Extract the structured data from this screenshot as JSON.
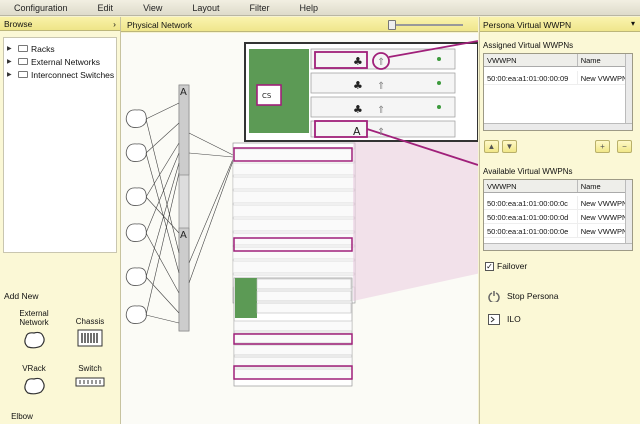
{
  "menu": [
    "Configuration",
    "Edit",
    "View",
    "Layout",
    "Filter",
    "Help"
  ],
  "left": {
    "title": "Browse",
    "tree": [
      "Racks",
      "External Networks",
      "Interconnect Switches"
    ],
    "add_new": "Add New",
    "palette": {
      "external_network": "External Network",
      "chassis": "Chassis",
      "vrack": "VRack",
      "switch": "Switch",
      "elbow": "Elbow"
    }
  },
  "center": {
    "title": "Physical Network",
    "chassis_label": "CS"
  },
  "right": {
    "title": "Persona Virtual WWPN",
    "assigned_label": "Assigned Virtual WWPNs",
    "assigned_headers": [
      "VWWPN",
      "Name"
    ],
    "assigned_rows": [
      [
        "50:00:ea:a1:01:00:00:09",
        "New VWWPN"
      ]
    ],
    "available_label": "Available Virtual WWPNs",
    "available_headers": [
      "VWWPN",
      "Name"
    ],
    "available_rows": [
      [
        "50:00:ea:a1:01:00:00:0c",
        "New VWWPN"
      ],
      [
        "50:00:ea:a1:01:00:00:0d",
        "New VWWPN"
      ],
      [
        "50:00:ea:a1:01:00:00:0e",
        "New VWWPN"
      ]
    ],
    "failover": "Failover",
    "stop_persona": "Stop Persona",
    "ilo": "ILO"
  },
  "colors": {
    "panel": "#fbf8d6",
    "header": "#efe68c",
    "highlight": "#a0207a",
    "blade": "#5c9a55"
  }
}
